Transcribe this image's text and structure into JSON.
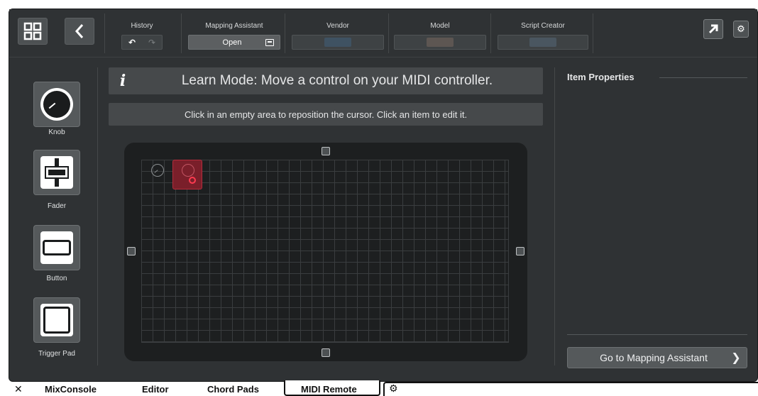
{
  "toolbar": {
    "history_label": "History",
    "undo_glyph": "↶",
    "redo_glyph": "↷",
    "mapping_assistant_label": "Mapping Assistant",
    "open_label": "Open",
    "vendor_label": "Vendor",
    "model_label": "Model",
    "script_creator_label": "Script Creator",
    "vendor_chip_color": "#3f5262",
    "model_chip_color": "#5d5652",
    "script_chip_color": "#4a5660"
  },
  "palette": {
    "items": [
      {
        "label": "Knob",
        "icon": "knob-icon"
      },
      {
        "label": "Fader",
        "icon": "fader-icon"
      },
      {
        "label": "Button",
        "icon": "button-icon"
      },
      {
        "label": "Trigger Pad",
        "icon": "trigger-pad-icon"
      }
    ]
  },
  "learn": {
    "icon_glyph": "i",
    "message": "Learn Mode: Move a control on your MIDI controller.",
    "hint": "Click in an empty area to reposition the cursor. Click an item to edit it."
  },
  "properties": {
    "title": "Item Properties",
    "goto_label": "Go to Mapping Assistant",
    "goto_chevron": "❯"
  },
  "tabs": {
    "close_glyph": "✕",
    "items": [
      "MixConsole",
      "Editor",
      "Chord Pads",
      "MIDI Remote"
    ],
    "active": "MIDI Remote",
    "gear_glyph": "⚙"
  },
  "colors": {
    "background": "#2f3234",
    "surface": "#1d1f20",
    "selection": "#7a1f2a",
    "accent_red": "#ff3b50"
  }
}
